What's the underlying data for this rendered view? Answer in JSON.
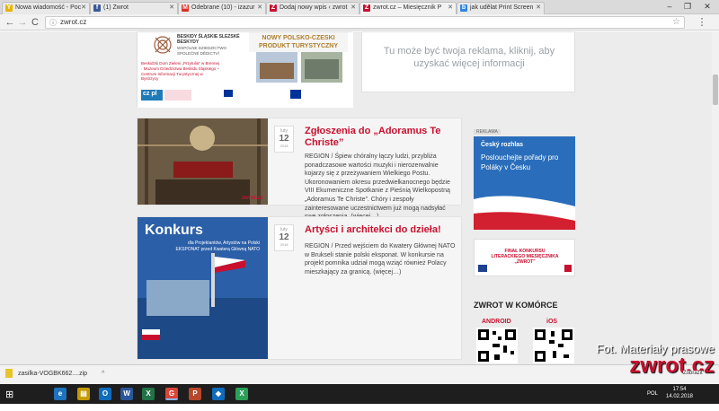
{
  "browser": {
    "tabs": [
      {
        "label": "Nowa wiadomość - Poc",
        "icon": "Y",
        "color": "#e8b400"
      },
      {
        "label": "(1) Zwrot",
        "icon": "f",
        "color": "#3b5998"
      },
      {
        "label": "Odebrane (10) - izazur",
        "icon": "M",
        "color": "#d93025"
      },
      {
        "label": "Dodaj nowy wpis ‹ zwrot",
        "icon": "Z",
        "color": "#c8102e"
      },
      {
        "label": "zwrot.cz – Miesięcznik P",
        "icon": "Z",
        "color": "#c8102e"
      },
      {
        "label": "jak udělat Print Screen",
        "icon": "b",
        "color": "#2e86de"
      }
    ],
    "window_controls": [
      "–",
      "❐",
      "✕"
    ],
    "url": "zwrot.cz",
    "info_icon": "ⓘ",
    "star_icon": "☆",
    "back": "←",
    "forward": "→",
    "reload": "C",
    "menu": "⋮"
  },
  "banner": {
    "title": "BESKIDY ŚLĄSKIE SLEZSKÉ BESKYDY",
    "subtitle": "WSPÓLNE DZIEDZICTWO SPOLEČNÉ DĚDICTVÍ",
    "headline": "NOWY POLSKO-CZESKI PRODUKT TURYSTYCZNY",
    "partners": "Beskidzki Dom Zieleni „Przytulia” w Brennej · Muzeum Dziedzictwa Beskidu Śląskiego – Centrum Informacji Turystycznej w Bystrzycy",
    "brand": "cz pl"
  },
  "ad_right": {
    "text": "Tu może być twoja reklama, kliknij, aby uzyskać więcej informacji"
  },
  "posts": [
    {
      "month": "luty",
      "day": "12",
      "year": "2018",
      "title": "Zgłoszenia do „Adoramus Te Christe”",
      "body": "REGION / Śpiew chóralny łączy ludzi, przybliża ponadczasowe wartości muzyki i nierozerwalnie kojarzy się z przeżywaniem Wielkiego Postu. Ukoronowaniem okresu przedwielkanocnego będzie VIII Ekumeniczne Spotkanie z Pieśnią Wielkopostną „Adoramus Te Christe”. Chóry i zespoły zainteresowane uczestnictwem już mogą nadsyłać swe zgłoszenia. (więcej…)",
      "thumb_caption": "zwrot.cz"
    },
    {
      "month": "luty",
      "day": "12",
      "year": "2018",
      "title": "Artyści i architekci do dzieła!",
      "body": "REGION / Przed wejściem do Kwatery Głównej NATO w Brukseli stanie polski eksponat. W konkursie na projekt pomnika udział mogą wziąć również Polacy mieszkający za granicą. (więcej…)",
      "thumb_title": "Konkurs",
      "thumb_sub": "dla Projektantów, Artystów na Polski EKSPONAT przed Kwaterą Główną NATO"
    }
  ],
  "sidebar": {
    "ad_label": "REKLAMA",
    "cr_logo": "Český rozhlas",
    "cr_slogan": "Poslouchejte pořady pro Poláky v Česku",
    "contest_text": "FINAŁ KONKURSU LITERACKIEGO MIESIĘCZNIKA „ZWROT”",
    "zwrot_heading": "ZWROT W KOMÓRCE",
    "android": "ANDROID",
    "ios": "iOS"
  },
  "download": {
    "filename": "zasilka-VOGBK662....zip",
    "caret": "^"
  },
  "watermark": {
    "line1": "Fot. Materiały prasowe",
    "line2": "zwrot.cz"
  },
  "taskbar": {
    "start": "⊞",
    "apps": [
      {
        "label": "e",
        "color": "#1e73be"
      },
      {
        "label": "▤",
        "color": "#c49a00"
      },
      {
        "label": "O",
        "color": "#0f6cbd"
      },
      {
        "label": "W",
        "color": "#2b579a"
      },
      {
        "label": "X",
        "color": "#217346"
      },
      {
        "label": "G",
        "color": "#db4437"
      },
      {
        "label": "P",
        "color": "#b7472a"
      },
      {
        "label": "◆",
        "color": "#0f6cbd"
      },
      {
        "label": "X",
        "color": "#2aa05a"
      }
    ],
    "lang": "POL",
    "time": "17:54",
    "date": "14.02.2018",
    "zoom": "Zobrazit"
  }
}
